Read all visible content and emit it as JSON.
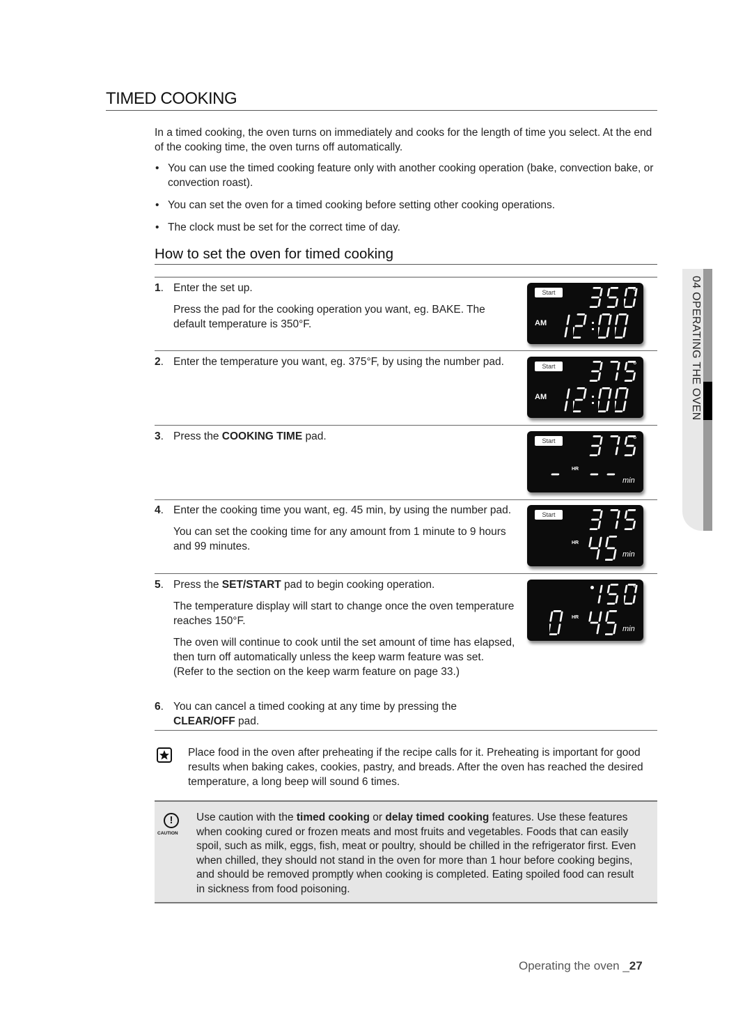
{
  "header": {
    "title": "TIMED COOKING",
    "intro": "In a timed cooking, the oven turns on immediately and cooks for the length of time you select. At the end of the cooking time, the oven turns off automatically.",
    "bullets": [
      "You can use the timed cooking feature only with another cooking operation (bake, convection bake, or convection roast).",
      "You can set the oven for a timed cooking before setting other cooking operations.",
      "The clock must be set for the correct time of day."
    ]
  },
  "section": {
    "title": "How to set the oven for timed cooking",
    "steps": [
      {
        "num": "1",
        "paras": [
          {
            "parts": [
              {
                "t": "Enter the set up."
              }
            ]
          },
          {
            "parts": [
              {
                "t": "Press the pad for the cooking operation you want, eg. BAKE. The default temperature is 350°F."
              }
            ]
          }
        ]
      },
      {
        "num": "2",
        "paras": [
          {
            "parts": [
              {
                "t": "Enter the temperature you want, eg. 375°F, by using the number pad."
              }
            ]
          }
        ]
      },
      {
        "num": "3",
        "paras": [
          {
            "parts": [
              {
                "t": "Press the "
              },
              {
                "t": "COOKING TIME",
                "b": true
              },
              {
                "t": " pad."
              }
            ]
          }
        ]
      },
      {
        "num": "4",
        "paras": [
          {
            "parts": [
              {
                "t": "Enter the cooking time you want, eg. 45 min, by using the number pad."
              }
            ]
          },
          {
            "parts": [
              {
                "t": "You can set the cooking time for any amount from 1 minute to 9 hours and 99 minutes."
              }
            ]
          }
        ]
      },
      {
        "num": "5",
        "paras": [
          {
            "parts": [
              {
                "t": "Press the "
              },
              {
                "t": "SET/START",
                "b": true
              },
              {
                "t": " pad to begin cooking operation."
              }
            ]
          },
          {
            "parts": [
              {
                "t": "The temperature display will start to change once the oven temperature reaches 150°F."
              }
            ]
          },
          {
            "parts": [
              {
                "t": "The oven will continue to cook until the set amount of time has elapsed, then turn off automatically unless the keep warm feature was set. (Refer to the section on the keep warm feature on page 33.)"
              }
            ]
          }
        ]
      },
      {
        "num": "6",
        "paras": [
          {
            "parts": [
              {
                "t": "You can cancel a timed cooking at any time by pressing the "
              },
              {
                "t": "CLEAR/OFF",
                "b": true
              },
              {
                "t": " pad."
              }
            ]
          }
        ]
      }
    ]
  },
  "displays": [
    {
      "start_label": "Start",
      "temp": "350",
      "degree": "°",
      "left_label": "AM",
      "bottom": "12:00",
      "unit": ""
    },
    {
      "start_label": "Start",
      "temp": "375",
      "degree": "°",
      "left_label": "AM",
      "bottom": "12:00",
      "unit": ""
    },
    {
      "start_label": "Start",
      "temp": "375",
      "degree": "°",
      "hr_label": "HR",
      "hours": "-",
      "minutes": "--",
      "unit": "min"
    },
    {
      "start_label": "Start",
      "temp": "375",
      "degree": "",
      "hr_label": "HR",
      "hours": "",
      "minutes": "45",
      "unit": "min"
    },
    {
      "start_label": "",
      "temp": "150",
      "degree": "°",
      "hr_label": "HR",
      "hours": "0",
      "minutes": "45",
      "unit": "min",
      "indicator_dot": true
    }
  ],
  "side_tab": {
    "label": "04  OPERATING THE OVEN"
  },
  "note": {
    "icon": "star-note-icon",
    "text": "Place food in the oven after preheating if the recipe calls for it. Preheating is important for good results when baking cakes, cookies, pastry, and breads. After the oven has reached the desired temperature, a long beep will sound 6 times."
  },
  "caution": {
    "icon_glyph": "!",
    "icon_label": "CAUTION",
    "parts": [
      {
        "t": "Use caution with the "
      },
      {
        "t": "timed cooking",
        "b": true
      },
      {
        "t": " or "
      },
      {
        "t": "delay timed cooking",
        "b": true
      },
      {
        "t": " features. Use these features when cooking cured or frozen meats and most fruits and vegetables. Foods that can easily spoil, such as milk, eggs, fish, meat or poultry, should be chilled in the refrigerator first. Even when chilled, they should not stand in the oven for more than 1 hour before cooking begins, and should be removed promptly when cooking is completed. Eating spoiled food can result in sickness from food poisoning."
      }
    ]
  },
  "footer": {
    "section": "Operating the oven _",
    "page": "27"
  }
}
